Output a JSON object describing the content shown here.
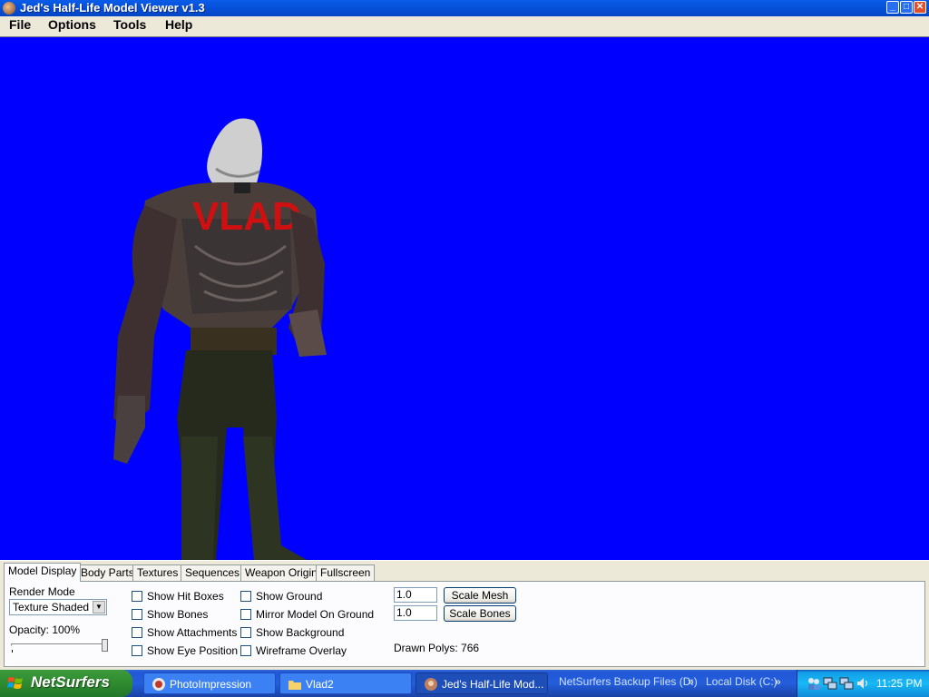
{
  "window": {
    "title": "Jed's Half-Life Model Viewer v1.3"
  },
  "menu": {
    "items": [
      "File",
      "Options",
      "Tools",
      "Help"
    ]
  },
  "viewport": {
    "background": "#0000ff",
    "model_label": "VLAD"
  },
  "tabs": [
    "Model Display",
    "Body Parts",
    "Textures",
    "Sequences",
    "Weapon Origin",
    "Fullscreen"
  ],
  "model_display": {
    "render_mode_label": "Render Mode",
    "render_mode_value": "Texture Shaded",
    "opacity_label": "Opacity: 100%",
    "opacity": 1.0,
    "checkboxes_col1": [
      "Show Hit Boxes",
      "Show Bones",
      "Show Attachments",
      "Show Eye Position"
    ],
    "checkboxes_col2": [
      "Show Ground",
      "Mirror Model On Ground",
      "Show Background",
      "Wireframe Overlay"
    ],
    "scale_mesh_value": "1.0",
    "scale_bones_value": "1.0",
    "scale_mesh_button": "Scale Mesh",
    "scale_bones_button": "Scale Bones",
    "drawn_polys": "Drawn Polys: 766"
  },
  "taskbar": {
    "start_label": "NetSurfers",
    "tasks": [
      "PhotoImpression",
      "Vlad2",
      "Jed's Half-Life Mod..."
    ],
    "bands": [
      "NetSurfers Backup Files (D:)",
      "Local Disk (C:)"
    ],
    "clock": "11:25 PM"
  }
}
